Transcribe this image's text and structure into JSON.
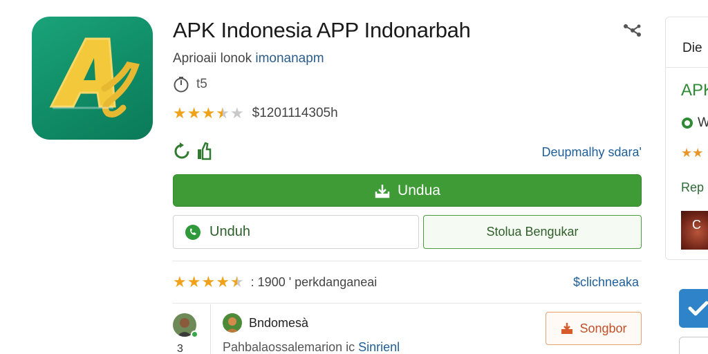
{
  "app": {
    "title": "APK Indonesia APP Indonarbah",
    "subtitle_prefix": "Aprioaii lonok ",
    "subtitle_link": "imonanapm",
    "meta_value": "t5",
    "rating_value": 3.5,
    "rating_text": "$1201114305h",
    "developer_link": "Deupmalhy sdara'"
  },
  "buttons": {
    "primary_label": "Undua",
    "secondary_label": "Unduh",
    "outline_label": "Stolua Bengukar",
    "report_label": "Songbor"
  },
  "reviews": {
    "rating_value": 4.5,
    "summary_text": ": 1900 ' perkdanganeai",
    "see_all_link": "$clichneaka",
    "count": "3",
    "reviewer_name": "Bndomesà",
    "review_text_prefix": "Pahbalaossalemarion ic ",
    "review_text_link": "Sinrienl"
  },
  "sidebar": {
    "heading": "Die",
    "app_name": "APK",
    "check_text": "W",
    "stars_text": "★★",
    "rep_text": "Rep",
    "thumb_text": "C"
  },
  "colors": {
    "brand_green": "#3f9b35",
    "icon_green": "#0f8a64",
    "link_blue": "#1f5f99",
    "star_orange": "#f0a21b",
    "report_orange": "#c0502a",
    "check_blue": "#2f83c9"
  },
  "icons": {
    "share": "share-icon",
    "meta": "clock-icon",
    "download": "download-icon",
    "whatsapp": "whatsapp-icon",
    "report": "report-icon",
    "check": "check-icon"
  }
}
